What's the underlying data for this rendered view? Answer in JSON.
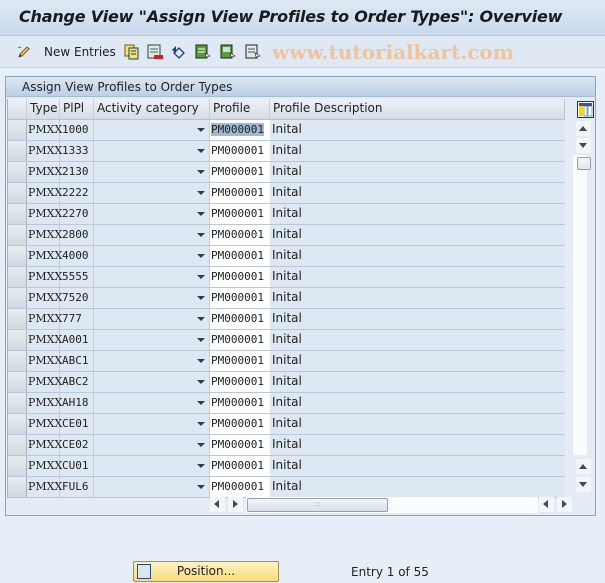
{
  "window": {
    "title": "Change View \"Assign View Profiles to Order Types\": Overview"
  },
  "toolbar": {
    "items": [
      {
        "icon": "edit-pencil-icon"
      },
      {
        "label": "New Entries"
      },
      {
        "icon": "copy-icon"
      },
      {
        "icon": "delete-icon"
      },
      {
        "icon": "undo-change-icon"
      },
      {
        "icon": "select-all-icon"
      },
      {
        "icon": "select-block-icon"
      },
      {
        "icon": "deselect-all-icon"
      }
    ],
    "new_entries_label": "New Entries",
    "watermark": "www.tutorialkart.com"
  },
  "panel": {
    "title": "Assign View Profiles to Order Types"
  },
  "table": {
    "columns": [
      "Type",
      "PlPl",
      "Activity category",
      "Profile",
      "Profile Description"
    ],
    "rows": [
      {
        "type": "PMXX",
        "plpl": "1000",
        "activity": "",
        "profile": "PM000001",
        "desc": "Inital"
      },
      {
        "type": "PMXX",
        "plpl": "1333",
        "activity": "",
        "profile": "PM000001",
        "desc": "Inital"
      },
      {
        "type": "PMXX",
        "plpl": "2130",
        "activity": "",
        "profile": "PM000001",
        "desc": "Inital"
      },
      {
        "type": "PMXX",
        "plpl": "2222",
        "activity": "",
        "profile": "PM000001",
        "desc": "Inital"
      },
      {
        "type": "PMXX",
        "plpl": "2270",
        "activity": "",
        "profile": "PM000001",
        "desc": "Inital"
      },
      {
        "type": "PMXX",
        "plpl": "2800",
        "activity": "",
        "profile": "PM000001",
        "desc": "Inital"
      },
      {
        "type": "PMXX",
        "plpl": "4000",
        "activity": "",
        "profile": "PM000001",
        "desc": "Inital"
      },
      {
        "type": "PMXX",
        "plpl": "5555",
        "activity": "",
        "profile": "PM000001",
        "desc": "Inital"
      },
      {
        "type": "PMXX",
        "plpl": "7520",
        "activity": "",
        "profile": "PM000001",
        "desc": "Inital"
      },
      {
        "type": "PMXX",
        "plpl": "777",
        "activity": "",
        "profile": "PM000001",
        "desc": "Inital"
      },
      {
        "type": "PMXX",
        "plpl": "A001",
        "activity": "",
        "profile": "PM000001",
        "desc": "Inital"
      },
      {
        "type": "PMXX",
        "plpl": "ABC1",
        "activity": "",
        "profile": "PM000001",
        "desc": "Inital"
      },
      {
        "type": "PMXX",
        "plpl": "ABC2",
        "activity": "",
        "profile": "PM000001",
        "desc": "Inital"
      },
      {
        "type": "PMXX",
        "plpl": "AH18",
        "activity": "",
        "profile": "PM000001",
        "desc": "Inital"
      },
      {
        "type": "PMXX",
        "plpl": "CE01",
        "activity": "",
        "profile": "PM000001",
        "desc": "Inital"
      },
      {
        "type": "PMXX",
        "plpl": "CE02",
        "activity": "",
        "profile": "PM000001",
        "desc": "Inital"
      },
      {
        "type": "PMXX",
        "plpl": "CU01",
        "activity": "",
        "profile": "PM000001",
        "desc": "Inital"
      },
      {
        "type": "PMXX",
        "plpl": "FUL6",
        "activity": "",
        "profile": "PM000001",
        "desc": "Inital"
      }
    ]
  },
  "footer": {
    "position_button": "Position...",
    "entry_status": "Entry 1 of 55"
  }
}
